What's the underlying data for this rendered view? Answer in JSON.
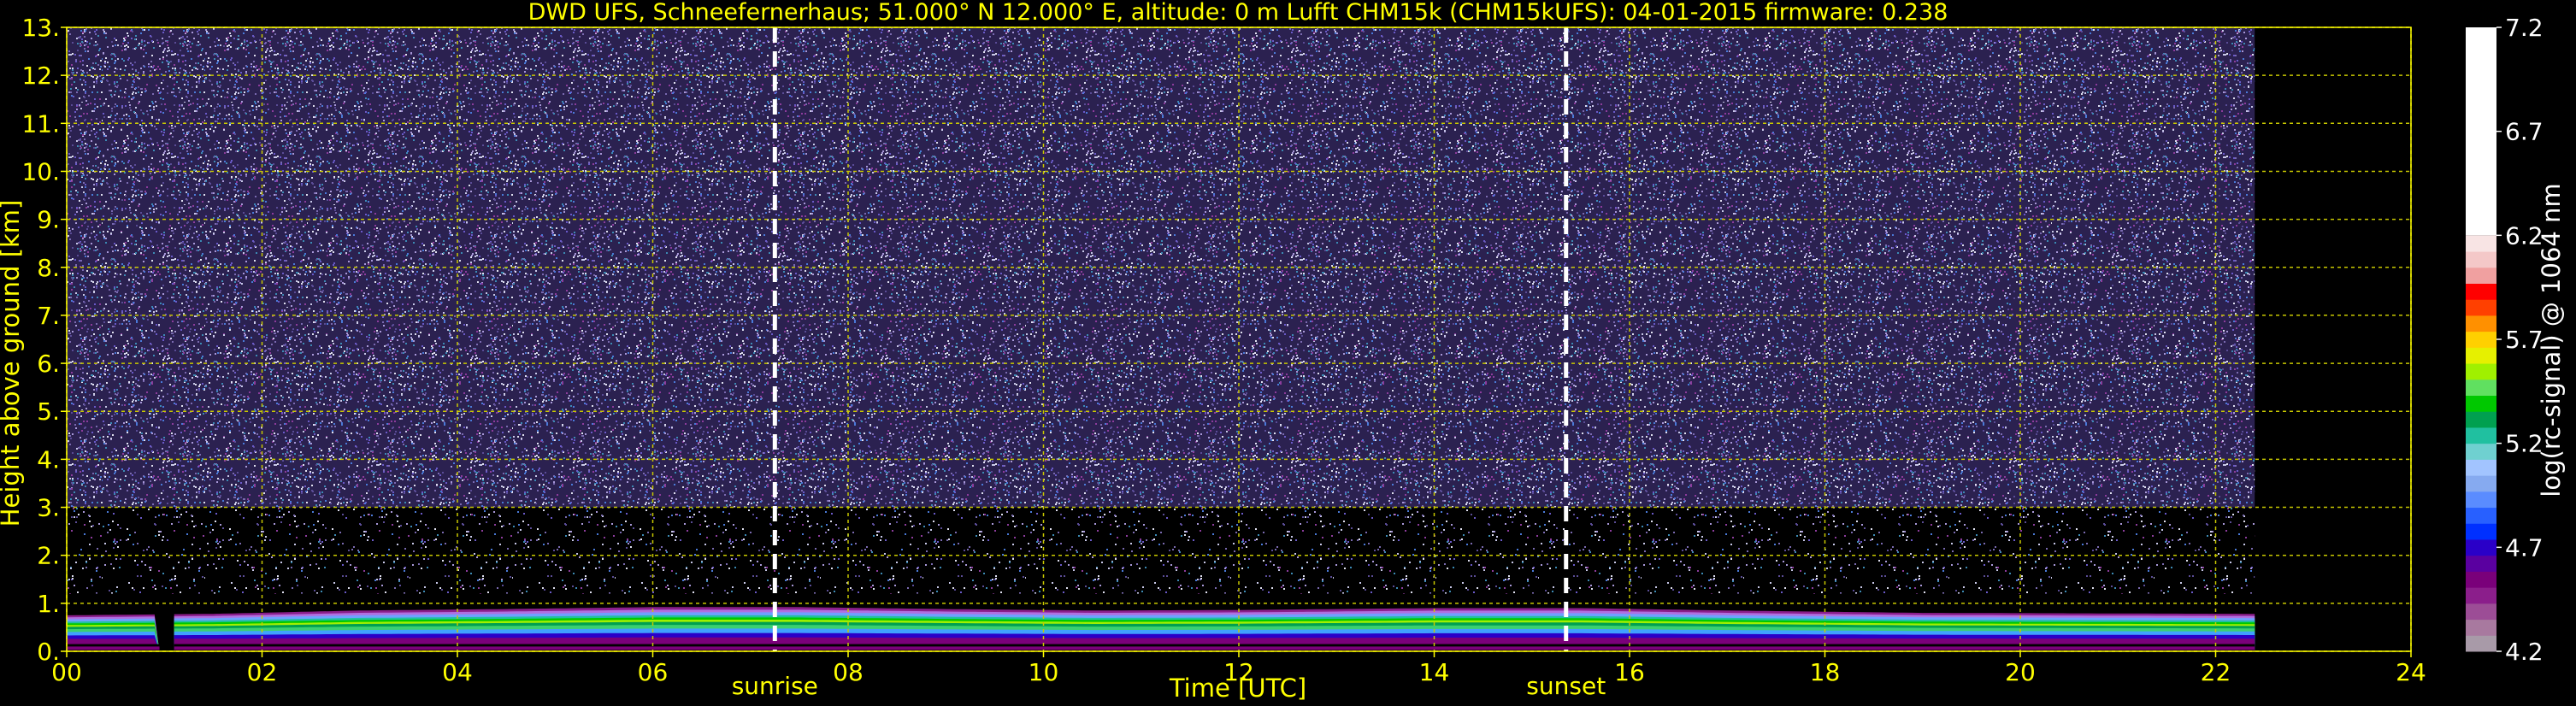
{
  "chart_data": {
    "type": "heatmap",
    "title": "DWD UFS, Schneefernerhaus; 51.000° N 12.000° E, altitude: 0 m    Lufft CHM15k (CHM15kUFS): 04-01-2015    firmware: 0.238",
    "xlabel": "Time [UTC]",
    "ylabel": "Height above ground [km]",
    "xlim": [
      0,
      24
    ],
    "ylim": [
      0,
      13
    ],
    "x_ticks": [
      0,
      2,
      4,
      6,
      8,
      10,
      12,
      14,
      16,
      18,
      20,
      22,
      24
    ],
    "x_tick_labels": [
      "00",
      "02",
      "04",
      "06",
      "08",
      "10",
      "12",
      "14",
      "16",
      "18",
      "20",
      "22",
      "24"
    ],
    "y_ticks": [
      0,
      1,
      2,
      3,
      4,
      5,
      6,
      7,
      8,
      9,
      10,
      11,
      12,
      13
    ],
    "y_tick_labels": [
      "0.",
      "1.",
      "2.",
      "3.",
      "4.",
      "5.",
      "6.",
      "7.",
      "8.",
      "9.",
      "10.",
      "11.",
      "12.",
      "13."
    ],
    "grid": true,
    "data_end_hour": 22.4,
    "data_gap_hours": [
      0.95,
      1.1
    ],
    "boundary_layer": {
      "base_km": 0.15,
      "top_km": [
        0.75,
        0.78,
        0.85,
        0.88,
        0.92,
        0.92,
        0.88,
        0.85,
        0.86,
        0.9,
        0.9,
        0.85,
        0.8,
        0.78
      ],
      "top_hours": [
        0,
        1.5,
        3,
        4.5,
        6,
        7.5,
        9,
        10.5,
        12,
        14,
        15.5,
        17,
        19,
        22.4
      ]
    },
    "annotations": [
      {
        "label": "sunrise",
        "x": 7.25
      },
      {
        "label": "sunset",
        "x": 15.35
      }
    ],
    "colorbar": {
      "label": "log(rc-signal) @ 1064 nm",
      "range": [
        4.2,
        7.2
      ],
      "ticks": [
        "7.2",
        "6.7",
        "6.2",
        "5.7",
        "5.2",
        "4.7",
        "4.2"
      ],
      "tick_values": [
        7.2,
        6.7,
        6.2,
        5.7,
        5.2,
        4.7,
        4.2
      ],
      "colors": [
        "#a89aa8",
        "#a8799f",
        "#9c4d96",
        "#8b1e8b",
        "#7a007a",
        "#5a00a0",
        "#2a00c8",
        "#0030ff",
        "#2860ff",
        "#5a8cff",
        "#86aaf0",
        "#a2c4ff",
        "#6fd0d0",
        "#20c0a0",
        "#00a050",
        "#00c800",
        "#60e060",
        "#a0f000",
        "#e6f000",
        "#ffd000",
        "#ff9000",
        "#ff4000",
        "#ff0000",
        "#f0a0a0",
        "#f4c8c8",
        "#f8e4e4",
        "#ffffff"
      ]
    }
  }
}
